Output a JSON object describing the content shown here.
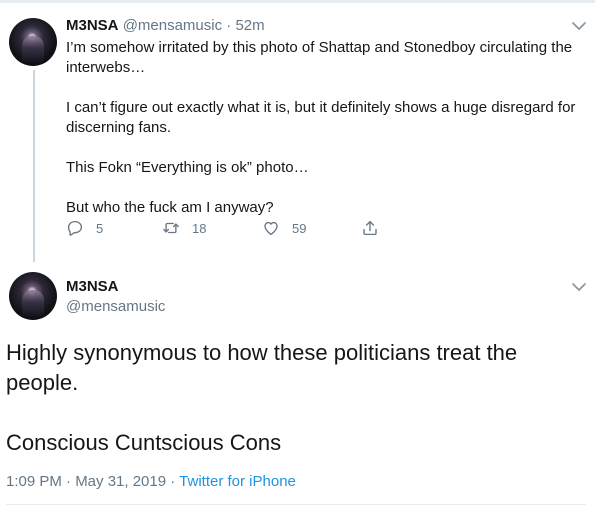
{
  "reply_tweet": {
    "author_name": "M3NSA",
    "author_handle": "@mensamusic",
    "separator": "·",
    "time_ago": "52m",
    "paragraphs": [
      "I’m somehow irritated by this photo of Shattap and Stonedboy circulating the interwebs…",
      "I can’t figure out exactly what it is, but it definitely shows a huge disregard for discerning fans.",
      "This Fokn “Everything is ok” photo…",
      "But who the fuck am I anyway?"
    ],
    "actions": {
      "reply_count": "5",
      "retweet_count": "18",
      "like_count": "59"
    },
    "icons": [
      "reply-icon",
      "retweet-icon",
      "like-icon",
      "share-icon",
      "chevron-down-icon"
    ]
  },
  "main_tweet": {
    "author_name": "M3NSA",
    "author_handle": "@mensamusic",
    "paragraphs": [
      "Highly synonymous to how these politicians treat the people.",
      "Conscious Cuntscious Cons"
    ],
    "timestamp": "1:09 PM · May 31, 2019",
    "meta_separator": "·",
    "source": "Twitter for iPhone"
  },
  "colors": {
    "text": "#14171a",
    "muted": "#657786",
    "link": "#1b95e0",
    "line": "#ccd6dd"
  }
}
